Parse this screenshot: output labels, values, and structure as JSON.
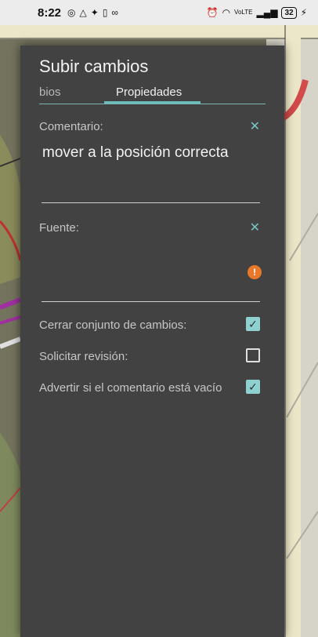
{
  "status_bar": {
    "time": "8:22",
    "left_icons": [
      "whatsapp-icon",
      "cloud-icon",
      "messenger-icon",
      "sim-icon",
      "voicemail-icon"
    ],
    "right_icons": [
      "alarm-icon",
      "wifi-icon",
      "volte-icon",
      "signal-icon"
    ],
    "battery": "32"
  },
  "dialog": {
    "title": "Subir cambios",
    "tabs": [
      {
        "label": "bios",
        "active": false
      },
      {
        "label": "Propiedades",
        "active": true
      }
    ],
    "comment": {
      "label": "Comentario:",
      "value": "mover a la posición correcta",
      "clear": "✕"
    },
    "source": {
      "label": "Fuente:",
      "value": "",
      "clear": "✕",
      "warning": "!"
    },
    "options": [
      {
        "label": "Cerrar conjunto de cambios:",
        "checked": true
      },
      {
        "label": "Solicitar revisión:",
        "checked": false
      },
      {
        "label": "Advertir si el comentario está vacío",
        "checked": true
      }
    ]
  },
  "colors": {
    "accent": "#6fbdbb",
    "dialog_bg": "#424242",
    "warning": "#e8782a"
  }
}
